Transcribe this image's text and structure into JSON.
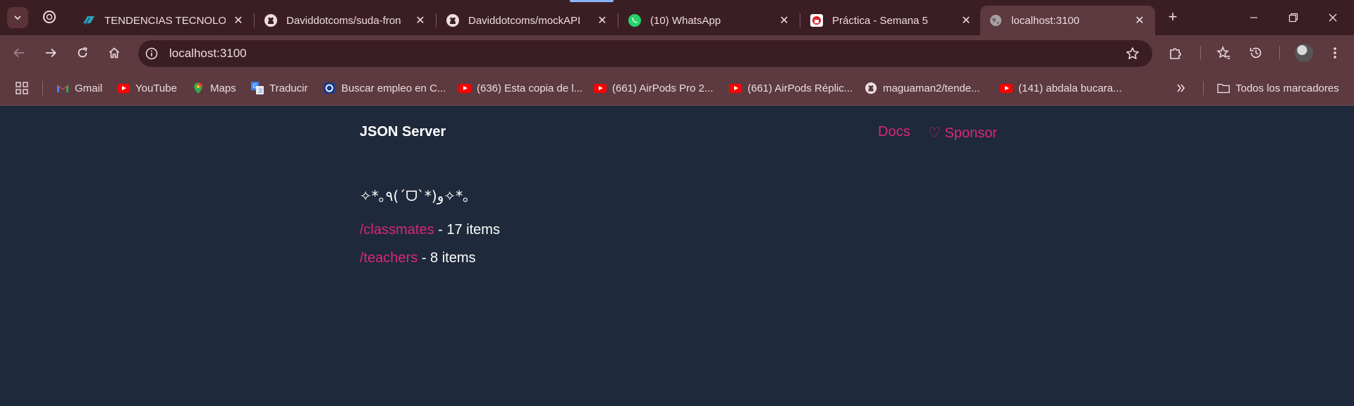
{
  "browser": {
    "tabs": [
      {
        "title": "TENDENCIAS TECNOLOGÍ",
        "icon": "layers-icon"
      },
      {
        "title": "Daviddotcoms/suda-fron",
        "icon": "github-icon"
      },
      {
        "title": "Daviddotcoms/mockAPI",
        "icon": "github-icon"
      },
      {
        "title": "(10) WhatsApp",
        "icon": "whatsapp-icon"
      },
      {
        "title": "Práctica - Semana 5",
        "icon": "moodle-icon"
      },
      {
        "title": "localhost:3100",
        "icon": "globe-icon",
        "active": true
      }
    ],
    "address": "localhost:3100",
    "bookmarks": [
      {
        "label": "Gmail",
        "icon": "gmail-icon"
      },
      {
        "label": "YouTube",
        "icon": "youtube-icon"
      },
      {
        "label": "Maps",
        "icon": "maps-icon"
      },
      {
        "label": "Traducir",
        "icon": "translate-icon"
      },
      {
        "label": "Buscar empleo en C...",
        "icon": "job-icon"
      },
      {
        "label": "(636) Esta copia de l...",
        "icon": "youtube-icon"
      },
      {
        "label": "(661) AirPods Pro 2...",
        "icon": "youtube-icon"
      },
      {
        "label": "(661) AirPods Réplic...",
        "icon": "youtube-icon"
      },
      {
        "label": "maguaman2/tende...",
        "icon": "github-icon"
      },
      {
        "label": "(141) abdala bucara...",
        "icon": "youtube-icon"
      }
    ],
    "all_bookmarks": "Todos los marcadores"
  },
  "page": {
    "brand": "JSON Server",
    "nav": {
      "docs": "Docs",
      "sponsor": "♡ Sponsor"
    },
    "kaomoji": "✧*｡٩(ˊᗜˋ*)و✧*｡",
    "resources": [
      {
        "path": "/classmates",
        "count_text": " - 17 items"
      },
      {
        "path": "/teachers",
        "count_text": " - 8 items"
      }
    ]
  },
  "colors": {
    "accent": "#db2777",
    "background": "#1e293b",
    "chrome": "#5c3a40"
  }
}
